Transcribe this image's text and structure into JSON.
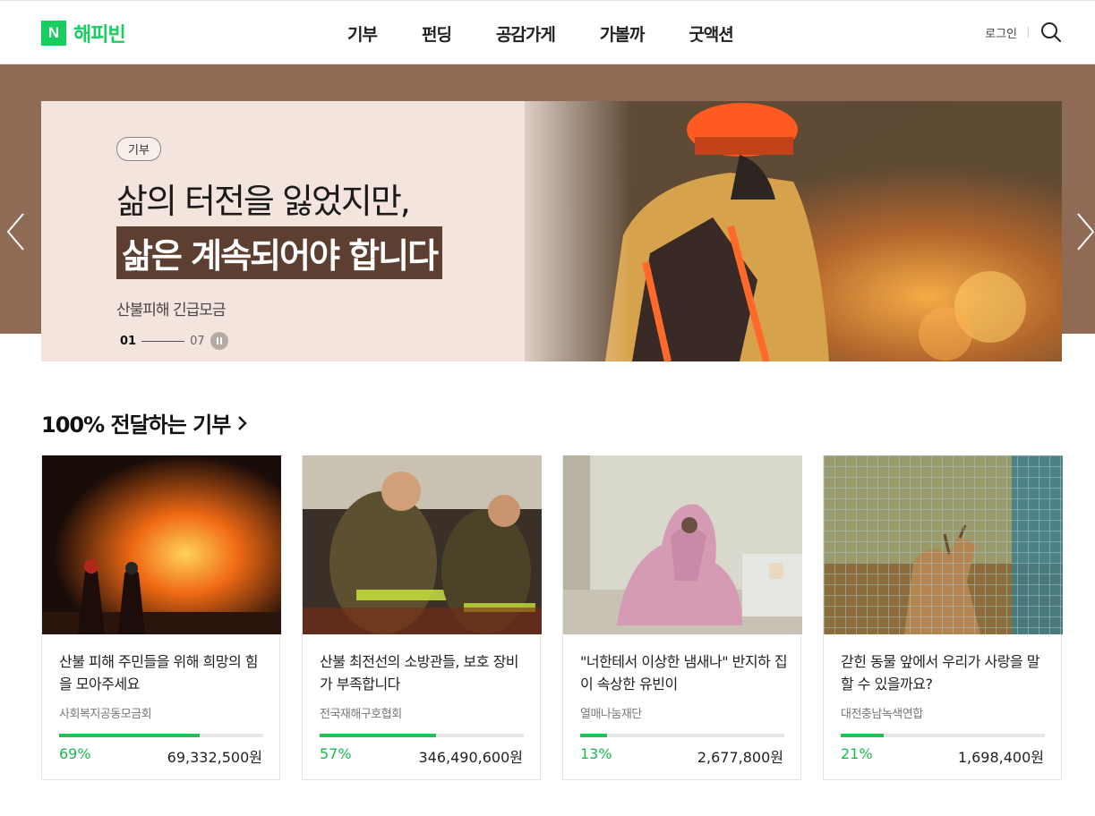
{
  "header": {
    "logo_mark": "N",
    "logo_text": "해피빈",
    "nav": [
      "기부",
      "펀딩",
      "공감가게",
      "가볼까",
      "굿액션"
    ],
    "login": "로그인",
    "search_icon": "search-icon"
  },
  "hero": {
    "tag": "기부",
    "headline_line1": "삶의 터전을 잃었지만,",
    "headline_line2": "삶은 계속되어야 합니다",
    "subtitle": "산불피해 긴급모금",
    "pager_current": "01",
    "pager_total": "07",
    "colors": {
      "band": "#8f6a55",
      "slide_bg": "#f3e4dd",
      "highlight": "#5c3f30"
    }
  },
  "section": {
    "title": "100% 전달하는 기부"
  },
  "cards": [
    {
      "title": "산불 피해 주민들을 위해 희망의 힘을 모아주세요",
      "org": "사회복지공동모금회",
      "percent_label": "69%",
      "progress": 69,
      "amount": "69,332,500원"
    },
    {
      "title": "산불 최전선의 소방관들, 보호 장비가 부족합니다",
      "org": "전국재해구호협회",
      "percent_label": "57%",
      "progress": 57,
      "amount": "346,490,600원"
    },
    {
      "title": "\"너한테서 이상한 냄새나\" 반지하 집이 속상한 유빈이",
      "org": "열매나눔재단",
      "percent_label": "13%",
      "progress": 13,
      "amount": "2,677,800원"
    },
    {
      "title": "갇힌 동물 앞에서 우리가 사랑을 말할 수 있을까요?",
      "org": "대전충남녹색연합",
      "percent_label": "21%",
      "progress": 21,
      "amount": "1,698,400원"
    }
  ],
  "colors": {
    "brand": "#19ce60",
    "progress": "#1ec153"
  }
}
